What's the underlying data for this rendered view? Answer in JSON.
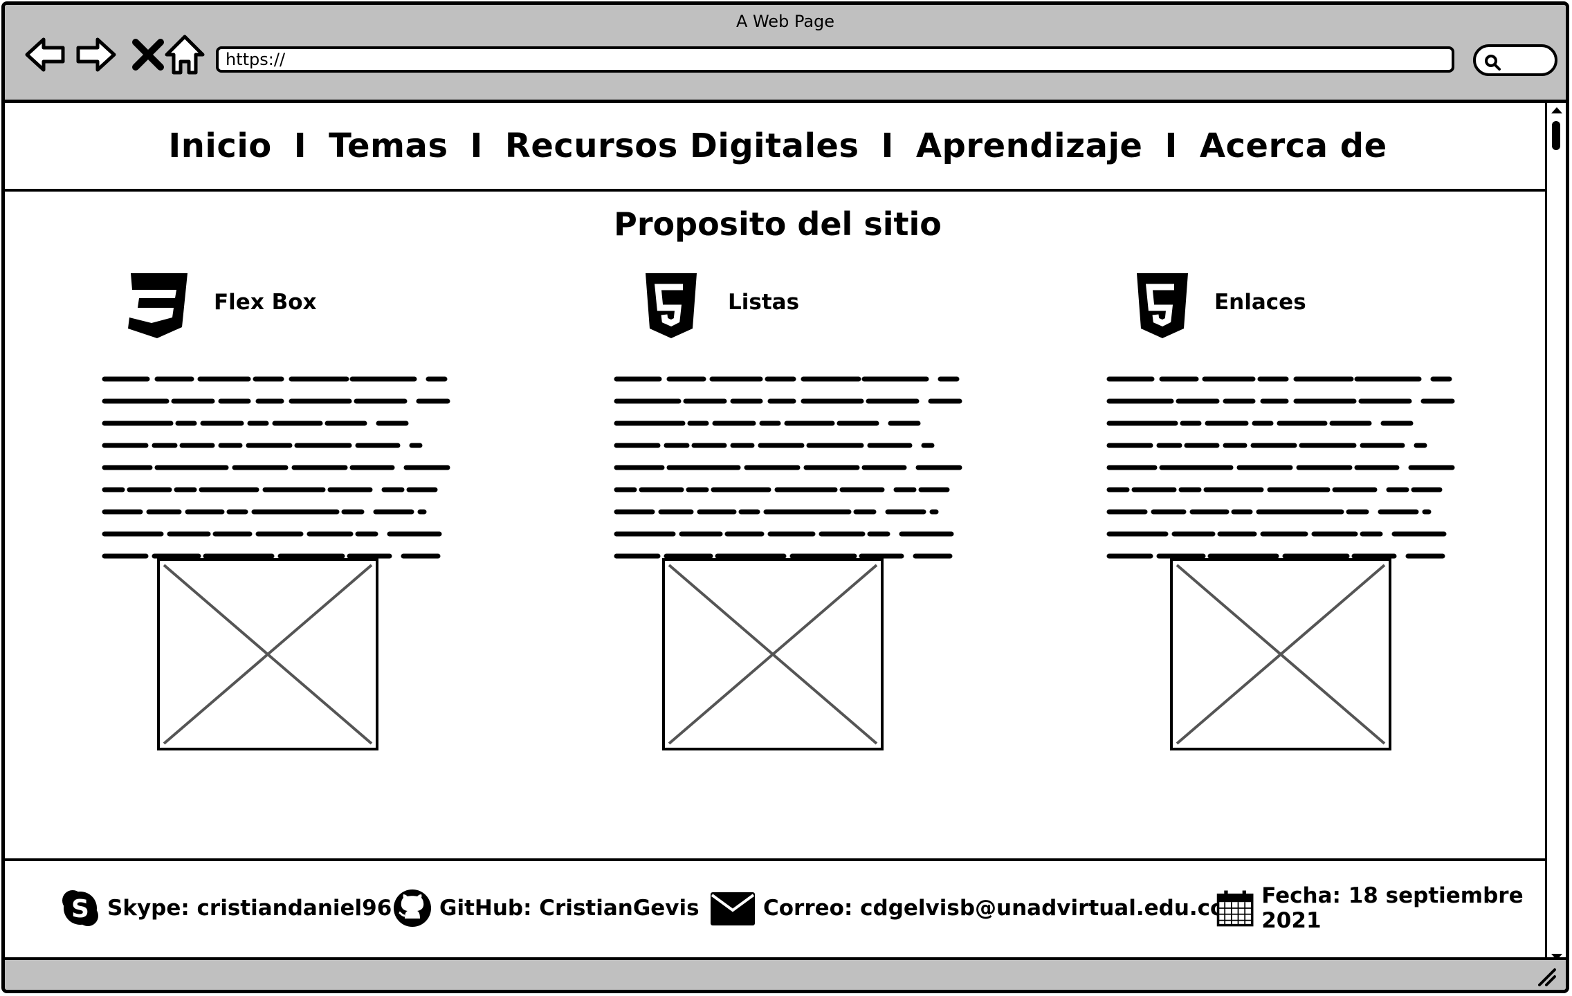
{
  "window": {
    "title": "A Web Page"
  },
  "browser": {
    "url": "https://",
    "buttons": [
      "back-arrow-icon",
      "forward-arrow-icon",
      "close-icon",
      "home-icon"
    ],
    "search_icon": "search-icon"
  },
  "nav": {
    "items": [
      "Inicio",
      "Temas",
      "Recursos Digitales",
      "Aprendizaje",
      "Acerca de"
    ],
    "separator": "I"
  },
  "main": {
    "heading": "Proposito del sitio",
    "cards": [
      {
        "title": "Flex Box",
        "icon": "css3-icon"
      },
      {
        "title": "Listas",
        "icon": "html5-icon"
      },
      {
        "title": "Enlaces",
        "icon": "html5-icon"
      }
    ]
  },
  "footer": {
    "skype": {
      "text": "Skype: cristiandaniel96",
      "icon": "skype-icon"
    },
    "github": {
      "text": "GitHub: CristianGevis",
      "icon": "github-icon"
    },
    "email": {
      "text": "Correo: cdgelvisb@unadvirtual.edu.co",
      "icon": "envelope-icon"
    },
    "date": {
      "text": "Fecha: 18 septiembre 2021",
      "icon": "calendar-icon"
    }
  }
}
